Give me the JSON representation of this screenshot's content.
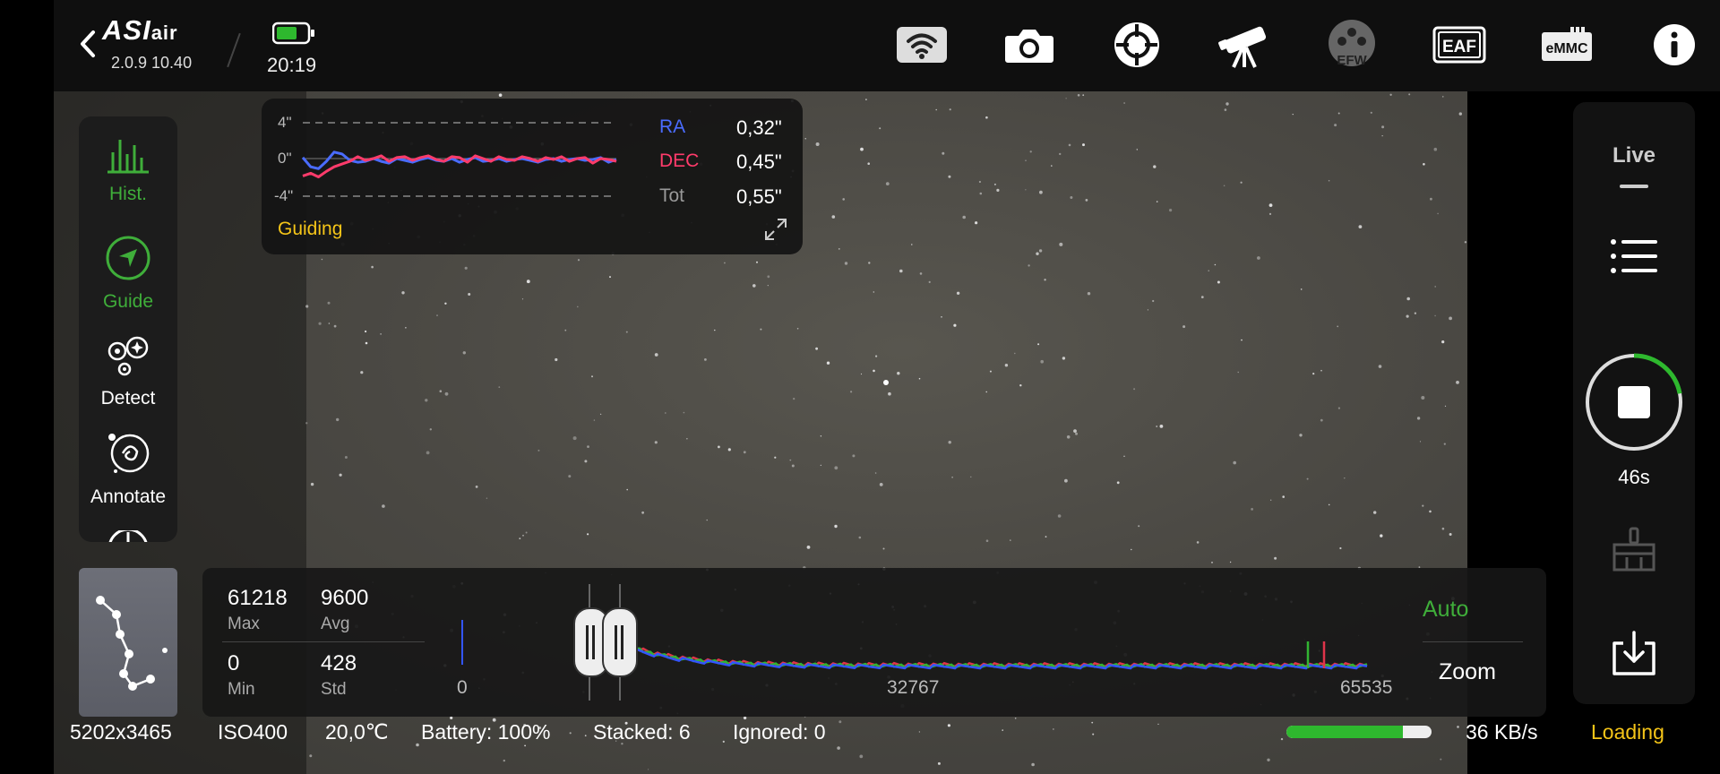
{
  "app": {
    "brand": "ASI",
    "brand_suffix": "air",
    "version": "2.0.9 10.40",
    "clock": "20:19"
  },
  "toolbar": {
    "icons": [
      "wifi-icon",
      "camera-icon",
      "guide-scope-icon",
      "telescope-icon",
      "efw-icon",
      "eaf-icon",
      "emmc-icon",
      "info-icon"
    ],
    "efw_label": "EFW",
    "eaf_label": "EAF",
    "emmc_label": "eMMC"
  },
  "left_nav": {
    "items": [
      {
        "label": "Hist.",
        "icon": "histogram-icon",
        "active": true
      },
      {
        "label": "Guide",
        "icon": "guide-icon",
        "active": true
      },
      {
        "label": "Detect",
        "icon": "detect-icon",
        "active": false
      },
      {
        "label": "Annotate",
        "icon": "annotate-icon",
        "active": false
      }
    ]
  },
  "guiding": {
    "title": "Guiding",
    "ticks": [
      "4\"",
      "0\"",
      "-4\""
    ],
    "ra_label": "RA",
    "ra_value": "0,32\"",
    "dec_label": "DEC",
    "dec_value": "0,45\"",
    "tot_label": "Tot",
    "tot_value": "0,55\"",
    "colors": {
      "ra": "#4a6cff",
      "dec": "#ff3b6b",
      "tot": "#999999"
    },
    "chart_data": {
      "type": "line",
      "ylim": [
        -4,
        4
      ],
      "series": [
        {
          "name": "RA",
          "values": [
            0.2,
            -0.8,
            -1.0,
            -0.2,
            0.8,
            0.6,
            -0.1,
            -0.3,
            -0.2,
            0.1,
            -0.2,
            -0.4,
            0.1,
            -0.1,
            -0.3,
            0.0,
            0.2,
            -0.1,
            -0.2,
            0.1,
            -0.3,
            0.0,
            0.2,
            -0.2,
            -0.1,
            0.1,
            -0.2,
            0.0,
            0.1,
            -0.1,
            -0.3,
            0.0,
            0.1,
            -0.2,
            0.0,
            0.1,
            -0.1,
            0.0,
            0.2,
            -0.3,
            0.0
          ]
        },
        {
          "name": "DEC",
          "values": [
            -1.8,
            -1.5,
            -1.9,
            -1.3,
            -0.8,
            -0.5,
            -0.2,
            0.3,
            -0.1,
            0.1,
            0.4,
            -0.2,
            0.2,
            0.3,
            -0.1,
            0.2,
            0.4,
            0.0,
            -0.2,
            0.3,
            0.2,
            -0.3,
            0.4,
            0.1,
            -0.2,
            0.3,
            0.0,
            -0.1,
            0.3,
            0.1,
            -0.2,
            0.2,
            0.0,
            0.3,
            -0.2,
            0.1,
            0.2,
            -0.4,
            0.1,
            0.0,
            -0.2
          ]
        }
      ]
    }
  },
  "histogram": {
    "max_value": "61218",
    "max_label": "Max",
    "avg_value": "9600",
    "avg_label": "Avg",
    "min_value": "0",
    "min_label": "Min",
    "std_value": "428",
    "std_label": "Std",
    "axis": [
      "0",
      "32767",
      "65535"
    ],
    "auto_label": "Auto",
    "zoom_label": "Zoom",
    "chart_data": {
      "type": "line",
      "x_range": [
        0,
        65535
      ],
      "series": [
        {
          "name": "red",
          "color": "#e0344a"
        },
        {
          "name": "green",
          "color": "#32b432"
        },
        {
          "name": "blue",
          "color": "#3355ff"
        }
      ]
    }
  },
  "right_panel": {
    "live_label": "Live",
    "timer": "46s",
    "timer_progress": 0.22,
    "icons": [
      "list-icon",
      "stop-icon",
      "broom-icon",
      "download-icon"
    ]
  },
  "status_bar": {
    "resolution": "5202x3465",
    "iso": "ISO400",
    "temperature": "20,0℃",
    "battery": "Battery: 100%",
    "stacked": "Stacked: 6",
    "ignored": "Ignored: 0",
    "transfer_progress": 0.8,
    "speed": "36 KB/s",
    "loading": "Loading"
  },
  "colors": {
    "accent_green": "#3fae3a",
    "warning_yellow": "#f5c518",
    "ra_blue": "#4a6cff",
    "dec_red": "#ff3b6b"
  }
}
